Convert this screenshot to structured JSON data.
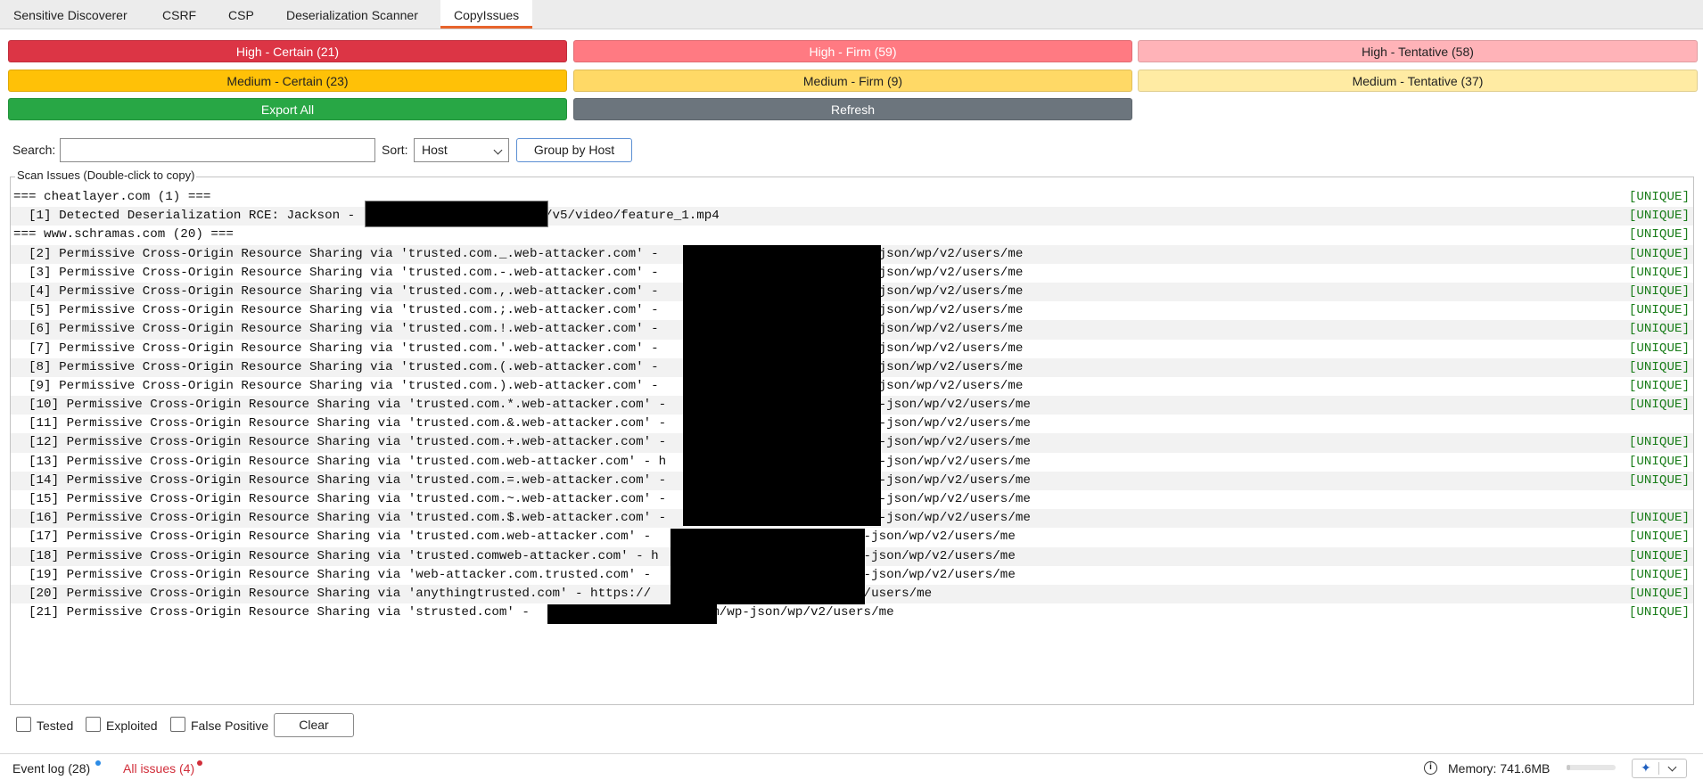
{
  "tabs": [
    {
      "label": "Sensitive Discoverer"
    },
    {
      "label": "CSRF"
    },
    {
      "label": "CSP"
    },
    {
      "label": "Deserialization Scanner"
    },
    {
      "label": "CopyIssues",
      "active": true
    }
  ],
  "filters": {
    "high_certain": "High - Certain (21)",
    "high_firm": "High - Firm (59)",
    "high_tentative": "High - Tentative (58)",
    "medium_certain": "Medium - Certain (23)",
    "medium_firm": "Medium - Firm (9)",
    "medium_tentative": "Medium - Tentative (37)",
    "export_all": "Export All",
    "refresh": "Refresh"
  },
  "colors": {
    "high_certain": "#dc3545",
    "high_firm": "#ff7a82",
    "high_tentative": "#ffb3b8",
    "medium_certain": "#ffc107",
    "medium_firm": "#ffd966",
    "medium_tentative": "#ffeba3",
    "export": "#28a745",
    "refresh": "#6c757d"
  },
  "search": {
    "label": "Search:",
    "value": "",
    "sort_label": "Sort:",
    "sort_value": "Host",
    "group_button": "Group by Host"
  },
  "panel": {
    "title": "Scan Issues (Double-click to copy)"
  },
  "issues": [
    {
      "text": "=== cheatlayer.com (1) ===",
      "badge": "[UNIQUE]"
    },
    {
      "text": "  [1] Detected Deserialization RCE: Jackson -                         /v5/video/feature_1.mp4",
      "badge": "[UNIQUE]"
    },
    {
      "text": "=== www.schramas.com (20) ===",
      "badge": "[UNIQUE]"
    },
    {
      "text": "  [2] Permissive Cross-Origin Resource Sharing via 'trusted.com._.web-attacker.com' -                          wp-json/wp/v2/users/me",
      "badge": "[UNIQUE]"
    },
    {
      "text": "  [3] Permissive Cross-Origin Resource Sharing via 'trusted.com.-.web-attacker.com' -                          wp-json/wp/v2/users/me",
      "badge": "[UNIQUE]"
    },
    {
      "text": "  [4] Permissive Cross-Origin Resource Sharing via 'trusted.com.,.web-attacker.com' -                          wp-json/wp/v2/users/me",
      "badge": "[UNIQUE]"
    },
    {
      "text": "  [5] Permissive Cross-Origin Resource Sharing via 'trusted.com.;.web-attacker.com' -                          wp-json/wp/v2/users/me",
      "badge": "[UNIQUE]"
    },
    {
      "text": "  [6] Permissive Cross-Origin Resource Sharing via 'trusted.com.!.web-attacker.com' -                          wp-json/wp/v2/users/me",
      "badge": "[UNIQUE]"
    },
    {
      "text": "  [7] Permissive Cross-Origin Resource Sharing via 'trusted.com.'.web-attacker.com' -                          wp-json/wp/v2/users/me",
      "badge": "[UNIQUE]"
    },
    {
      "text": "  [8] Permissive Cross-Origin Resource Sharing via 'trusted.com.(.web-attacker.com' -                          wp-json/wp/v2/users/me",
      "badge": "[UNIQUE]"
    },
    {
      "text": "  [9] Permissive Cross-Origin Resource Sharing via 'trusted.com.).web-attacker.com' -                          wp-json/wp/v2/users/me",
      "badge": "[UNIQUE]"
    },
    {
      "text": "  [10] Permissive Cross-Origin Resource Sharing via 'trusted.com.*.web-attacker.com' -                         /wp-json/wp/v2/users/me",
      "badge": "[UNIQUE]"
    },
    {
      "text": "  [11] Permissive Cross-Origin Resource Sharing via 'trusted.com.&.web-attacker.com' -                         /wp-json/wp/v2/users/me",
      "badge": ""
    },
    {
      "text": "  [12] Permissive Cross-Origin Resource Sharing via 'trusted.com.+.web-attacker.com' -                         /wp-json/wp/v2/users/me",
      "badge": "[UNIQUE]"
    },
    {
      "text": "  [13] Permissive Cross-Origin Resource Sharing via 'trusted.com.web-attacker.com' - h                         /wp-json/wp/v2/users/me",
      "badge": "[UNIQUE]"
    },
    {
      "text": "  [14] Permissive Cross-Origin Resource Sharing via 'trusted.com.=.web-attacker.com' -                         /wp-json/wp/v2/users/me",
      "badge": "[UNIQUE]"
    },
    {
      "text": "  [15] Permissive Cross-Origin Resource Sharing via 'trusted.com.~.web-attacker.com' -                         /wp-json/wp/v2/users/me",
      "badge": ""
    },
    {
      "text": "  [16] Permissive Cross-Origin Resource Sharing via 'trusted.com.$.web-attacker.com' -                         /wp-json/wp/v2/users/me",
      "badge": "[UNIQUE]"
    },
    {
      "text": "  [17] Permissive Cross-Origin Resource Sharing via 'trusted.com.web-attacker.com' -                         /wp-json/wp/v2/users/me",
      "badge": "[UNIQUE]"
    },
    {
      "text": "  [18] Permissive Cross-Origin Resource Sharing via 'trusted.comweb-attacker.com' - h                        /wp-json/wp/v2/users/me",
      "badge": "[UNIQUE]"
    },
    {
      "text": "  [19] Permissive Cross-Origin Resource Sharing via 'web-attacker.com.trusted.com' -                         /wp-json/wp/v2/users/me",
      "badge": "[UNIQUE]"
    },
    {
      "text": "  [20] Permissive Cross-Origin Resource Sharing via 'anythingtrusted.com' - https://                      /wp/v2/users/me",
      "badge": "[UNIQUE]"
    },
    {
      "text": "  [21] Permissive Cross-Origin Resource Sharing via 'strusted.com' -                      com/wp-json/wp/v2/users/me",
      "badge": "[UNIQUE]"
    }
  ],
  "checks": {
    "tested": "Tested",
    "exploited": "Exploited",
    "false_positive": "False Positive",
    "clear": "Clear"
  },
  "status": {
    "event_log": "Event log (28)",
    "all_issues": "All issues (4)",
    "memory": "Memory: 741.6MB",
    "memory_fraction": 0.08
  }
}
